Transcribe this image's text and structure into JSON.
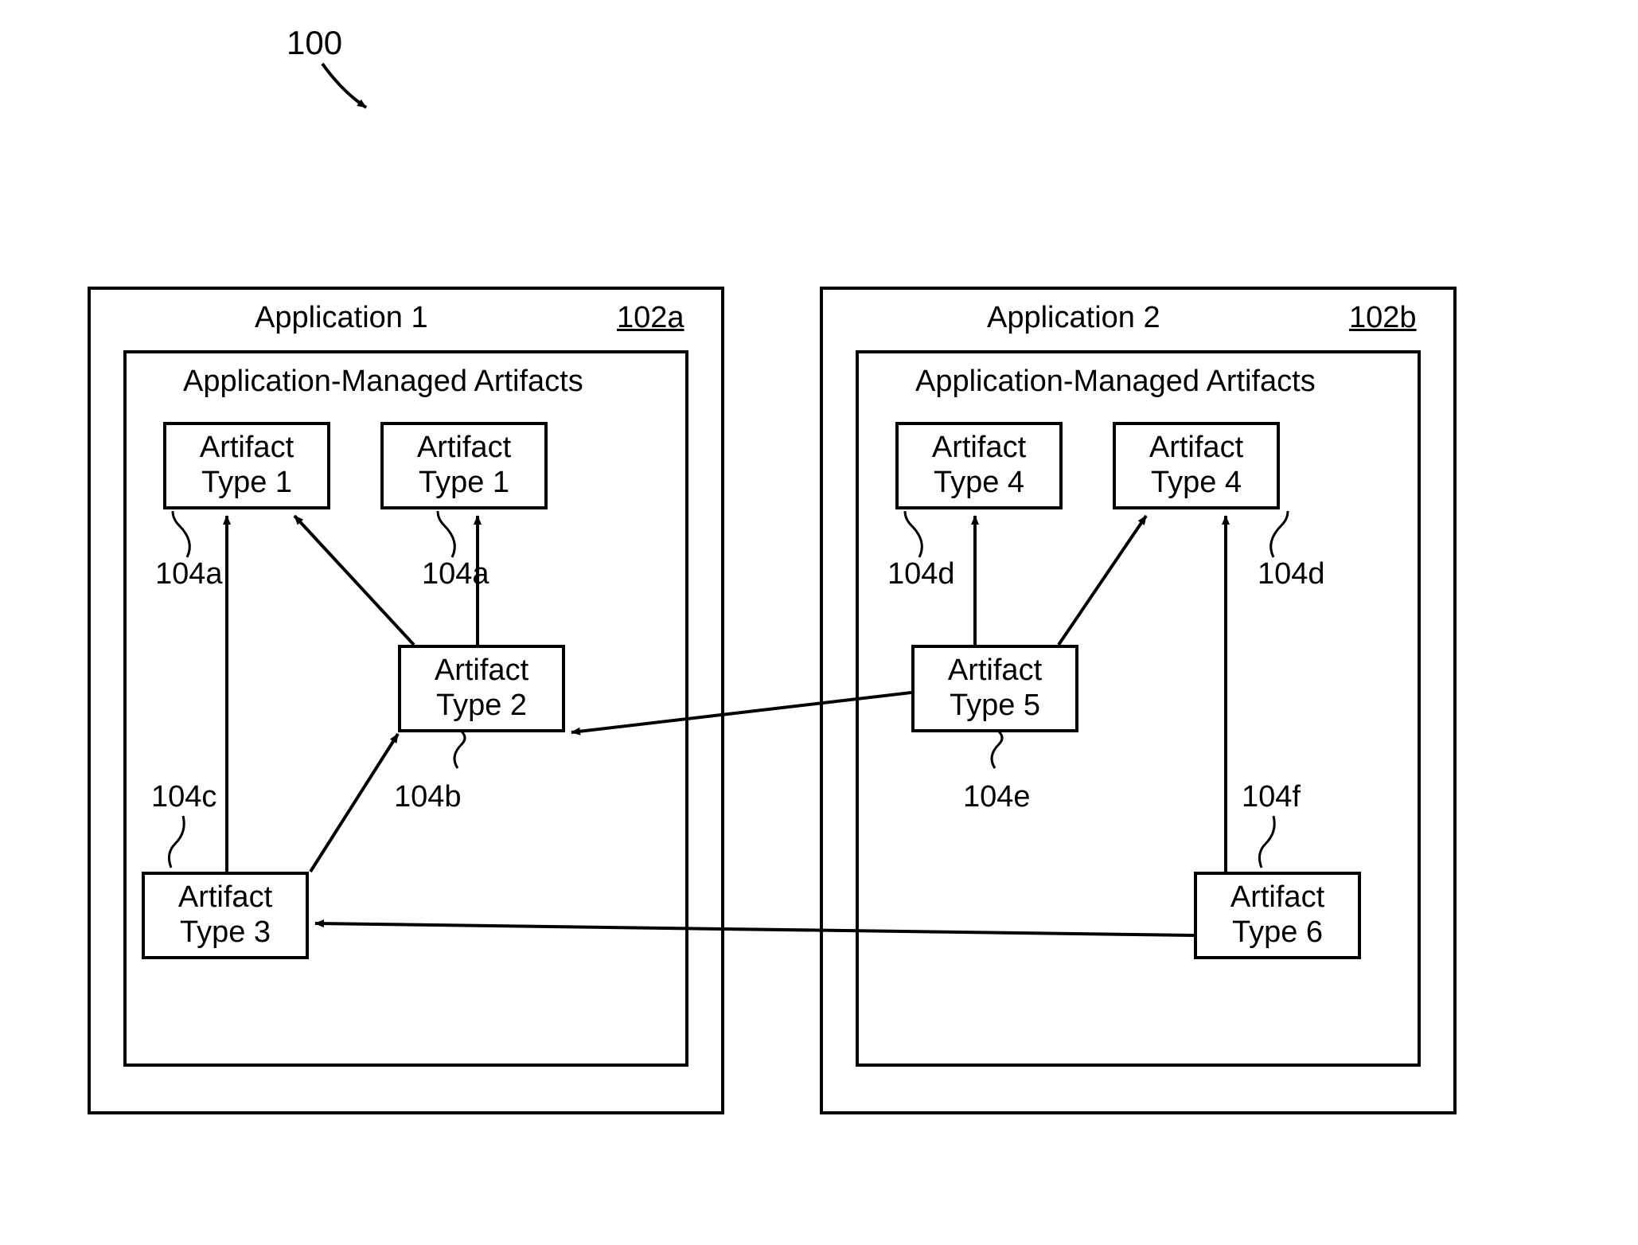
{
  "figure_ref": "100",
  "app1": {
    "title": "Application 1",
    "ref": "102a",
    "inner_title": "Application-Managed Artifacts",
    "artifacts": {
      "a1_left": {
        "line1": "Artifact",
        "line2": "Type 1",
        "ref": "104a"
      },
      "a1_right": {
        "line1": "Artifact",
        "line2": "Type 1",
        "ref": "104a"
      },
      "a2": {
        "line1": "Artifact",
        "line2": "Type 2",
        "ref": "104b"
      },
      "a3": {
        "line1": "Artifact",
        "line2": "Type 3",
        "ref": "104c"
      }
    }
  },
  "app2": {
    "title": "Application 2",
    "ref": "102b",
    "inner_title": "Application-Managed Artifacts",
    "artifacts": {
      "a4_left": {
        "line1": "Artifact",
        "line2": "Type 4",
        "ref": "104d"
      },
      "a4_right": {
        "line1": "Artifact",
        "line2": "Type 4",
        "ref": "104d"
      },
      "a5": {
        "line1": "Artifact",
        "line2": "Type 5",
        "ref": "104e"
      },
      "a6": {
        "line1": "Artifact",
        "line2": "Type 6",
        "ref": "104f"
      }
    }
  },
  "relationships": [
    {
      "from": "Artifact Type 3",
      "to": "Artifact Type 1 (left, App 1)"
    },
    {
      "from": "Artifact Type 3",
      "to": "Artifact Type 2"
    },
    {
      "from": "Artifact Type 2",
      "to": "Artifact Type 1 (left, App 1)"
    },
    {
      "from": "Artifact Type 2",
      "to": "Artifact Type 1 (right, App 1)"
    },
    {
      "from": "Artifact Type 5",
      "to": "Artifact Type 4 (left, App 2)"
    },
    {
      "from": "Artifact Type 5",
      "to": "Artifact Type 4 (right, App 2)"
    },
    {
      "from": "Artifact Type 6",
      "to": "Artifact Type 4 (right, App 2)"
    },
    {
      "from": "Artifact Type 5",
      "to": "Artifact Type 2 (cross-application)"
    },
    {
      "from": "Artifact Type 6",
      "to": "Artifact Type 3 (cross-application)"
    }
  ]
}
